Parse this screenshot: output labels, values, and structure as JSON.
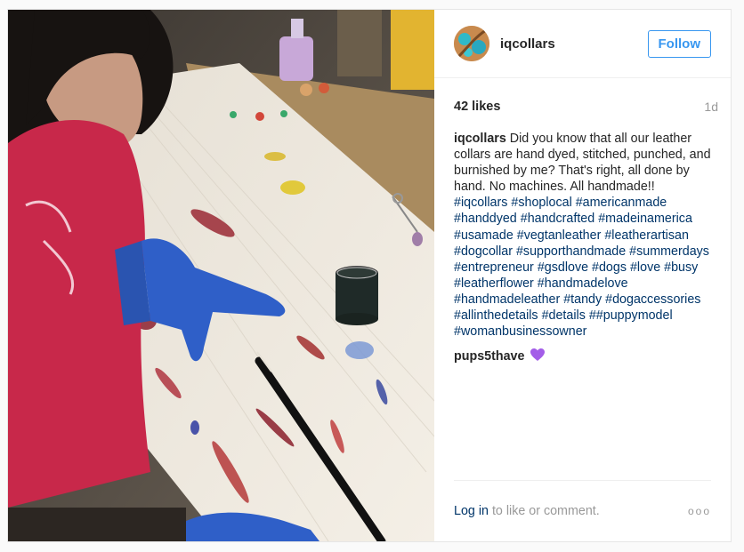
{
  "post": {
    "username": "iqcollars",
    "follow_label": "Follow",
    "likes": "42 likes",
    "time": "1d",
    "caption_author": "iqcollars",
    "caption_text": "Did you know that all our leather collars are hand dyed, stitched, punched, and burnished by me? That's right, all done by hand. No machines. All handmade!!",
    "hashtags": [
      "#iqcollars",
      "#shoplocal",
      "#americanmade",
      "#handdyed",
      "#handcrafted",
      "#madeinamerica",
      "#usamade",
      "#vegtanleather",
      "#leatherartisan",
      "#dogcollar",
      "#supporthandmade",
      "#summerdays",
      "#entrepreneur",
      "#gsdlove",
      "#dogs",
      "#love",
      "#busy",
      "#leatherflower",
      "#handmadelove",
      "#handmadeleather",
      "#tandy",
      "#dogaccessories",
      "#allinthedetails",
      "#details",
      "##puppymodel",
      "#womanbusinessowner"
    ],
    "comment_author": "pups5thave",
    "comment_emoji": "purple-heart-icon"
  },
  "footer": {
    "login_link": "Log in",
    "login_rest": "to like or comment.",
    "more_label": "ooo"
  },
  "colors": {
    "link": "#003569",
    "follow": "#3897f0",
    "shirt": "#c8284a",
    "glove": "#2f5fc8"
  }
}
